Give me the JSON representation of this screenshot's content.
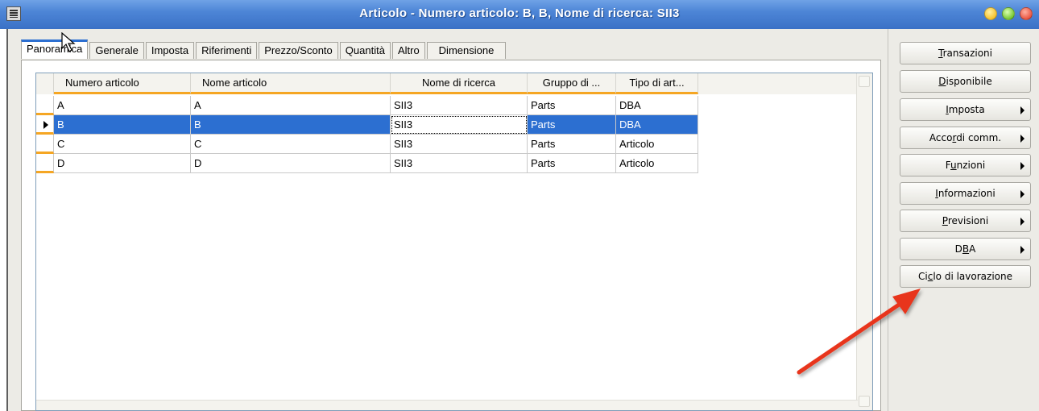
{
  "window": {
    "title": "Articolo - Numero articolo: B, B, Nome di ricerca: SII3"
  },
  "tabs": [
    {
      "label": "Panoramica",
      "active": true
    },
    {
      "label": "Generale"
    },
    {
      "label": "Imposta"
    },
    {
      "label": "Riferimenti"
    },
    {
      "label": "Prezzo/Sconto"
    },
    {
      "label": "Quantità"
    },
    {
      "label": "Altro"
    },
    {
      "label": "Dimensione"
    }
  ],
  "grid": {
    "columns": [
      "Numero articolo",
      "Nome articolo",
      "Nome di ricerca",
      "Gruppo di ...",
      "Tipo di art..."
    ],
    "rows": [
      [
        "A",
        "A",
        "SII3",
        "Parts",
        "DBA"
      ],
      [
        "B",
        "B",
        "SII3",
        "Parts",
        "DBA"
      ],
      [
        "C",
        "C",
        "SII3",
        "Parts",
        "Articolo"
      ],
      [
        "D",
        "D",
        "SII3",
        "Parts",
        "Articolo"
      ]
    ],
    "selected_row": 1
  },
  "buttons": [
    {
      "pre": "",
      "u": "T",
      "post": "ransazioni",
      "menu": false
    },
    {
      "pre": "",
      "u": "D",
      "post": "isponibile",
      "menu": false
    },
    {
      "pre": "",
      "u": "I",
      "post": "mposta",
      "menu": true
    },
    {
      "pre": "Acco",
      "u": "r",
      "post": "di comm.",
      "menu": true
    },
    {
      "pre": "F",
      "u": "u",
      "post": "nzioni",
      "menu": true
    },
    {
      "pre": "",
      "u": "I",
      "post": "nformazioni",
      "menu": true
    },
    {
      "pre": "",
      "u": "P",
      "post": "revisioni",
      "menu": true
    },
    {
      "pre": "D",
      "u": "B",
      "post": "A",
      "menu": true
    },
    {
      "pre": "Ci",
      "u": "c",
      "post": "lo di lavorazione",
      "menu": false
    }
  ],
  "colors": {
    "title_bar": "#4d85d6",
    "selection": "#2c6fd1",
    "header_accent": "#f5a623",
    "annotation_arrow": "#e8361f"
  }
}
